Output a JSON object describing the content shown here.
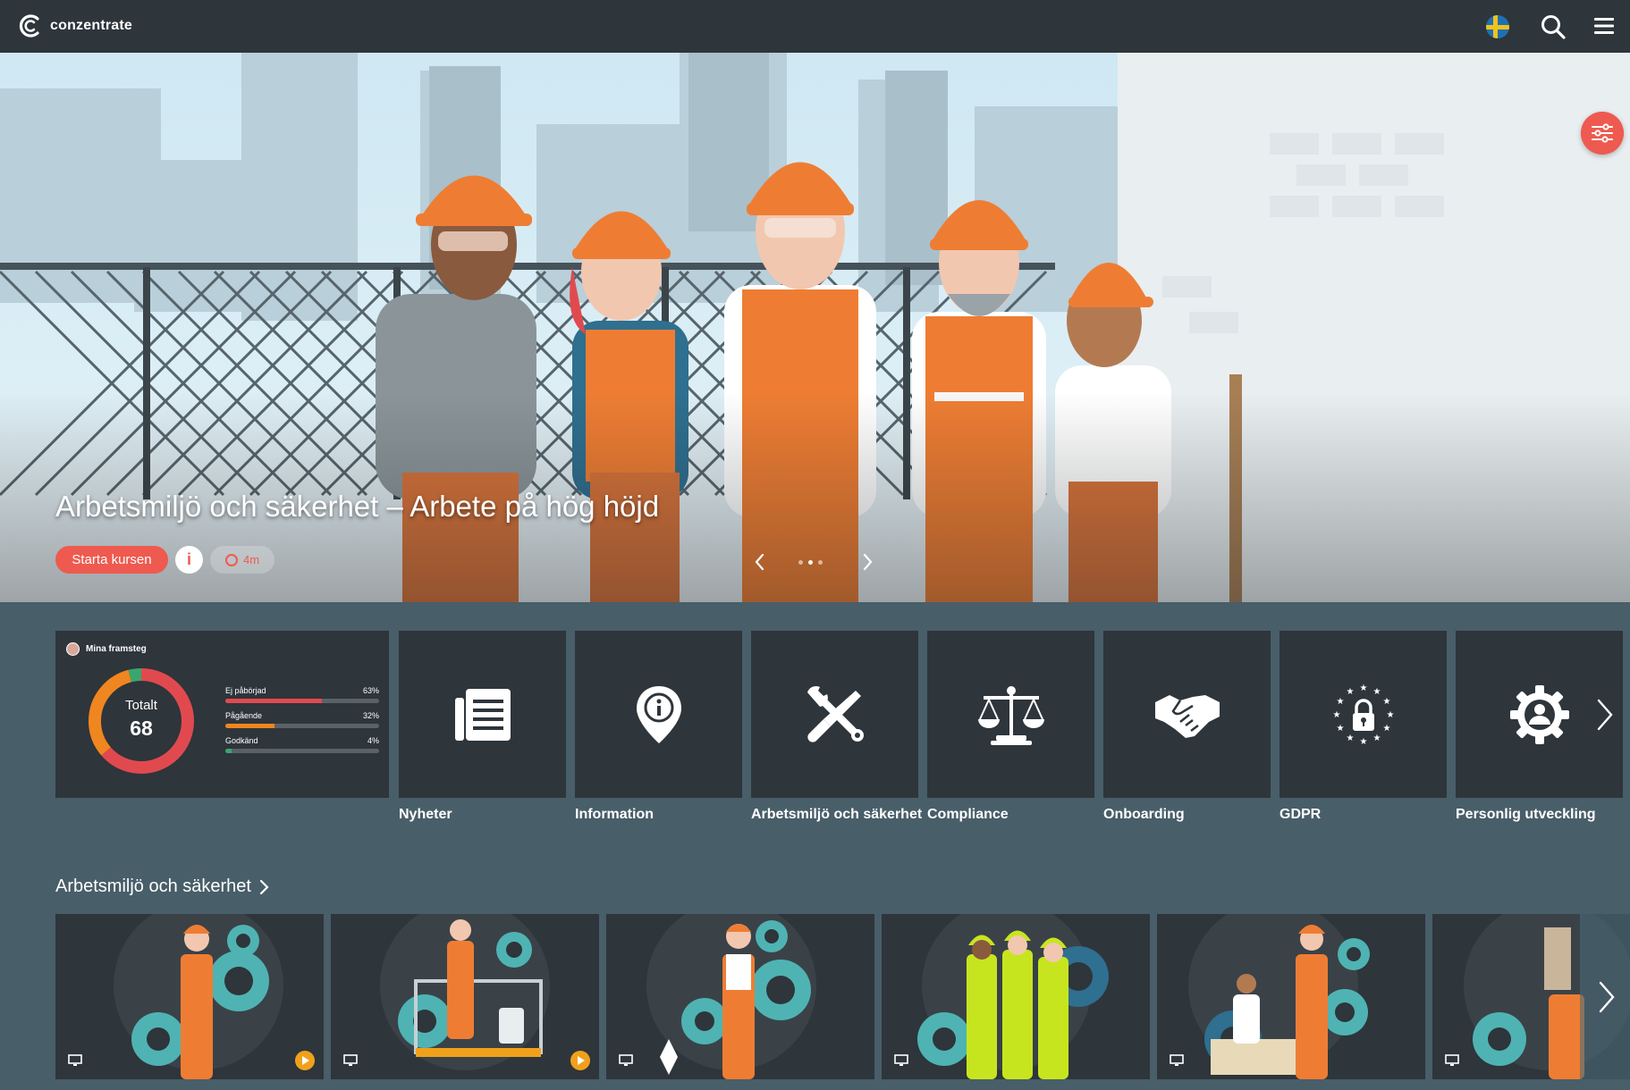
{
  "app": {
    "name": "conzentrate"
  },
  "hero": {
    "title": "Arbetsmiljö och säkerhet – Arbete på hög höjd",
    "start_label": "Starta kursen",
    "info_label": "i",
    "time_label": "4m"
  },
  "progress": {
    "title": "Mina framsteg",
    "total_label": "Totalt",
    "total_value": "68",
    "stats": [
      {
        "label": "Ej påbörjad",
        "pct_label": "63%",
        "value": 0.63,
        "color": "#e04a4f"
      },
      {
        "label": "Pågående",
        "pct_label": "32%",
        "value": 0.32,
        "color": "#f0861f"
      },
      {
        "label": "Godkänd",
        "pct_label": "4%",
        "value": 0.04,
        "color": "#3aa66f"
      }
    ]
  },
  "categories": [
    {
      "label": "Nyheter",
      "icon": "newspaper-icon"
    },
    {
      "label": "Information",
      "icon": "info-pin-icon"
    },
    {
      "label": "Arbetsmiljö och säkerhet",
      "icon": "tools-icon"
    },
    {
      "label": "Compliance",
      "icon": "scales-icon"
    },
    {
      "label": "Onboarding",
      "icon": "handshake-icon"
    },
    {
      "label": "GDPR",
      "icon": "eu-lock-icon"
    },
    {
      "label": "Personlig utveckling",
      "icon": "gear-person-icon"
    }
  ],
  "section": {
    "title": "Arbetsmiljö och säkerhet"
  },
  "colors": {
    "accent": "#ee5a4f",
    "topbar": "#2e353b",
    "background": "#485e69",
    "gear": "#4fb3b3",
    "hardhat": "#ee7d33"
  }
}
